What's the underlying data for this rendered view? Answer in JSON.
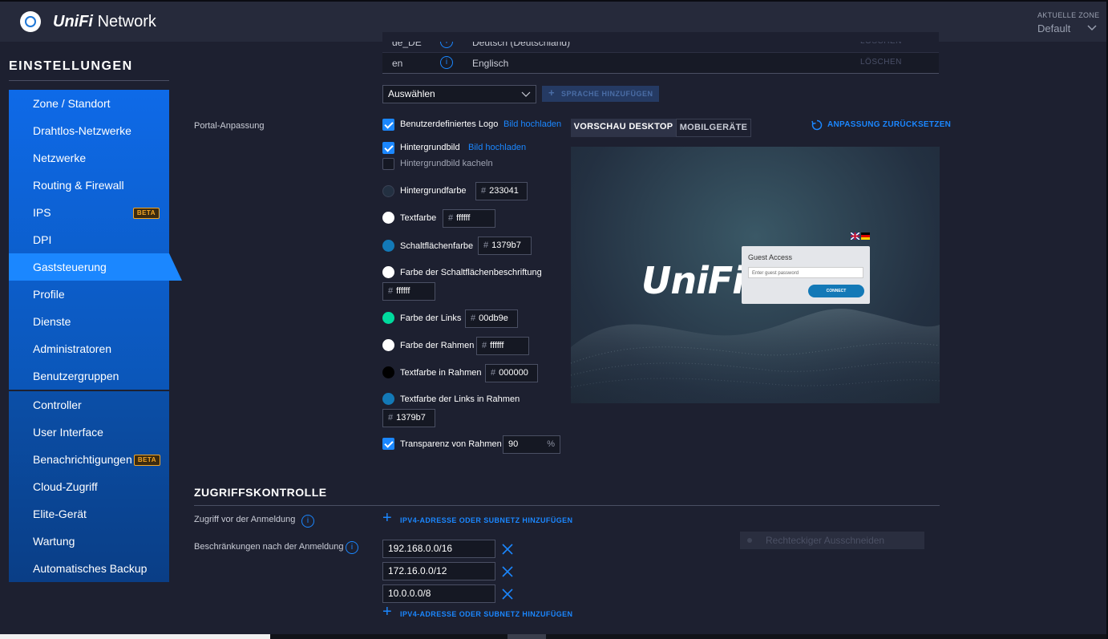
{
  "header": {
    "brand_uni": "UniFi",
    "brand_rest": "Network",
    "zone_label": "AKTUELLE ZONE",
    "zone_value": "Default"
  },
  "sidebar": {
    "title": "EINSTELLUNGEN",
    "group1": [
      {
        "label": "Zone / Standort"
      },
      {
        "label": "Drahtlos-Netzwerke"
      },
      {
        "label": "Netzwerke"
      },
      {
        "label": "Routing & Firewall"
      },
      {
        "label": "IPS",
        "badge": "BETA"
      },
      {
        "label": "DPI"
      },
      {
        "label": "Gaststeuerung",
        "active": true
      },
      {
        "label": "Profile"
      },
      {
        "label": "Dienste"
      },
      {
        "label": "Administratoren"
      },
      {
        "label": "Benutzergruppen"
      }
    ],
    "group2": [
      {
        "label": "Controller"
      },
      {
        "label": "User Interface"
      },
      {
        "label": "Benachrichtigungen",
        "badge": "BETA"
      },
      {
        "label": "Cloud-Zugriff"
      },
      {
        "label": "Elite-Gerät"
      },
      {
        "label": "Wartung"
      },
      {
        "label": "Automatisches Backup"
      }
    ]
  },
  "languages": [
    {
      "code": "de_DE",
      "name": "Deutsch (Deutschland)",
      "delete": "LÖSCHEN"
    },
    {
      "code": "en",
      "name": "Englisch",
      "delete": "LÖSCHEN"
    }
  ],
  "language_select": "Auswählen",
  "add_language": "SPRACHE HINZUFÜGEN",
  "portal": {
    "label": "Portal-Anpassung",
    "custom_logo": {
      "label": "Benutzerdefiniertes Logo",
      "checked": true,
      "link": "Bild hochladen"
    },
    "background_image": {
      "label": "Hintergrundbild",
      "checked": true,
      "link": "Bild hochladen"
    },
    "tile_background": {
      "label": "Hintergrundbild kacheln",
      "checked": false
    },
    "colors": [
      {
        "label": "Hintergrundfarbe",
        "value": "233041",
        "color": "#233041"
      },
      {
        "label": "Textfarbe",
        "value": "ffffff",
        "color": "#ffffff"
      },
      {
        "label": "Schaltflächenfarbe",
        "value": "1379b7",
        "color": "#1379b7"
      },
      {
        "label": "Farbe der Schaltflächenbeschriftung",
        "value": "ffffff",
        "color": "#ffffff"
      },
      {
        "label": "Farbe der Links",
        "value": "00db9e",
        "color": "#00db9e"
      },
      {
        "label": "Farbe der Rahmen",
        "value": "ffffff",
        "color": "#ffffff"
      },
      {
        "label": "Textfarbe in Rahmen",
        "value": "000000",
        "color": "#000000"
      },
      {
        "label": "Textfarbe der Links in Rahmen",
        "value": "1379b7",
        "color": "#1379b7"
      }
    ],
    "transparency": {
      "label": "Transparenz von Rahmen",
      "checked": true,
      "value": "90",
      "unit": "%"
    },
    "hash": "#"
  },
  "preview": {
    "tab_desktop": "VORSCHAU DESKTOP",
    "tab_mobile": "MOBILGERÄTE",
    "reset": "ANPASSUNG ZURÜCKSETZEN",
    "logo": "UniFi",
    "logo_mark": "®",
    "guest_title": "Guest Access",
    "guest_placeholder": "Enter guest password",
    "connect": "CONNECT"
  },
  "access_control": {
    "title": "ZUGRIFFSKONTROLLE",
    "pre_auth_label": "Zugriff vor der Anmeldung",
    "post_auth_label": "Beschränkungen nach der Anmeldung",
    "add_subnet": "IPV4-ADRESSE ODER SUBNETZ HINZUFÜGEN",
    "subnets": [
      "192.168.0.0/16",
      "172.16.0.0/12",
      "10.0.0.0/8"
    ]
  },
  "ghost_overlay": "Rechteckiger Ausschneiden",
  "colors": {
    "accent": "#1b87ff",
    "sidebar_blue": "#0b5fd6",
    "background": "#1d2030"
  }
}
